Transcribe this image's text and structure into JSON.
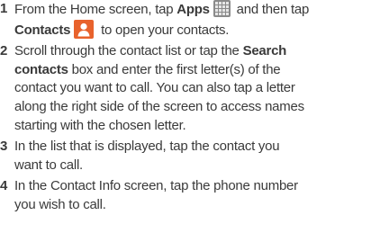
{
  "steps": [
    {
      "number": "1",
      "segments": {
        "a": "From the Home screen, tap ",
        "apps": "Apps",
        "b": " and then tap",
        "contacts": "Contacts",
        "c": " to open your contacts."
      },
      "icons": [
        "apps-grid-icon",
        "contacts-icon"
      ]
    },
    {
      "number": "2",
      "segments": {
        "a": "Scroll through the contact list or tap the ",
        "search": "Search contacts",
        "search_line1": "Search",
        "search_line2": "contacts",
        "b": " box and enter the first letter(s) of the",
        "c": "contact you want to call. You can also tap a letter",
        "d": "along the right side of the screen to access names",
        "e": "starting with the chosen letter."
      }
    },
    {
      "number": "3",
      "segments": {
        "a": "In the list that is displayed, tap the contact you",
        "b": "want to call."
      }
    },
    {
      "number": "4",
      "segments": {
        "a": "In the Contact Info screen, tap the phone number",
        "b": "you wish to call."
      }
    }
  ],
  "colors": {
    "text": "#3a3a3a",
    "apps_icon": "#8a8a8a",
    "contacts_icon": "#e8622c"
  }
}
